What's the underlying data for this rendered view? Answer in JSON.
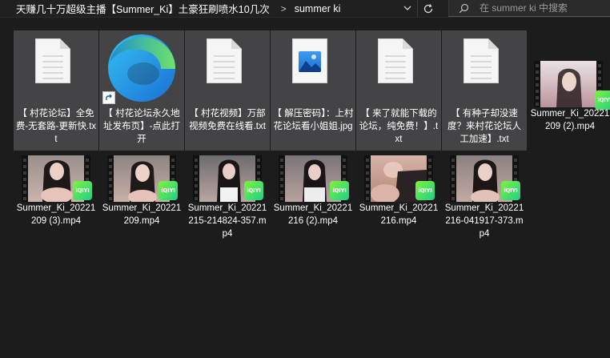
{
  "breadcrumb": {
    "folder": "天赚几十万超级主播【Summer_Ki】土豪狂刷喷水10几次",
    "separator": ">",
    "current": "summer ki"
  },
  "search": {
    "placeholder": "在 summer ki 中搜索"
  },
  "files": [
    {
      "kind": "txt",
      "label": "【 村花论坛】全免费-无套路-更新快.txt"
    },
    {
      "kind": "shortcut",
      "icon": "edge-icon",
      "label": "【 村花论坛永久地址发布页】-点此打开"
    },
    {
      "kind": "txt",
      "label": "【 村花视频】万部视频免费在线看.txt"
    },
    {
      "kind": "jpg",
      "label": "【 解压密码】：上村花论坛看小姐姐.jpg"
    },
    {
      "kind": "txt",
      "label": "【 来了就能下载的论坛，纯免费！】.txt"
    },
    {
      "kind": "txt",
      "label": "【 有种子却没速度？来村花论坛人工加速】.txt"
    },
    {
      "kind": "mp4",
      "label": "Summer_Ki_20221209 (2).mp4"
    },
    {
      "kind": "mp4",
      "label": "Summer_Ki_20221209 (3).mp4"
    },
    {
      "kind": "mp4",
      "label": "Summer_Ki_20221209.mp4"
    },
    {
      "kind": "mp4",
      "label": "Summer_Ki_20221215-214824-357.mp4"
    },
    {
      "kind": "mp4",
      "label": "Summer_Ki_20221216 (2).mp4"
    },
    {
      "kind": "mp4",
      "label": "Summer_Ki_20221216.mp4"
    },
    {
      "kind": "mp4",
      "label": "Summer_Ki_20221216-041917-373.mp4"
    }
  ],
  "video_badge": "iQIYI",
  "colors": {
    "background": "#1c1c1c",
    "selected_tile": "#444446",
    "text": "#ffffff"
  }
}
